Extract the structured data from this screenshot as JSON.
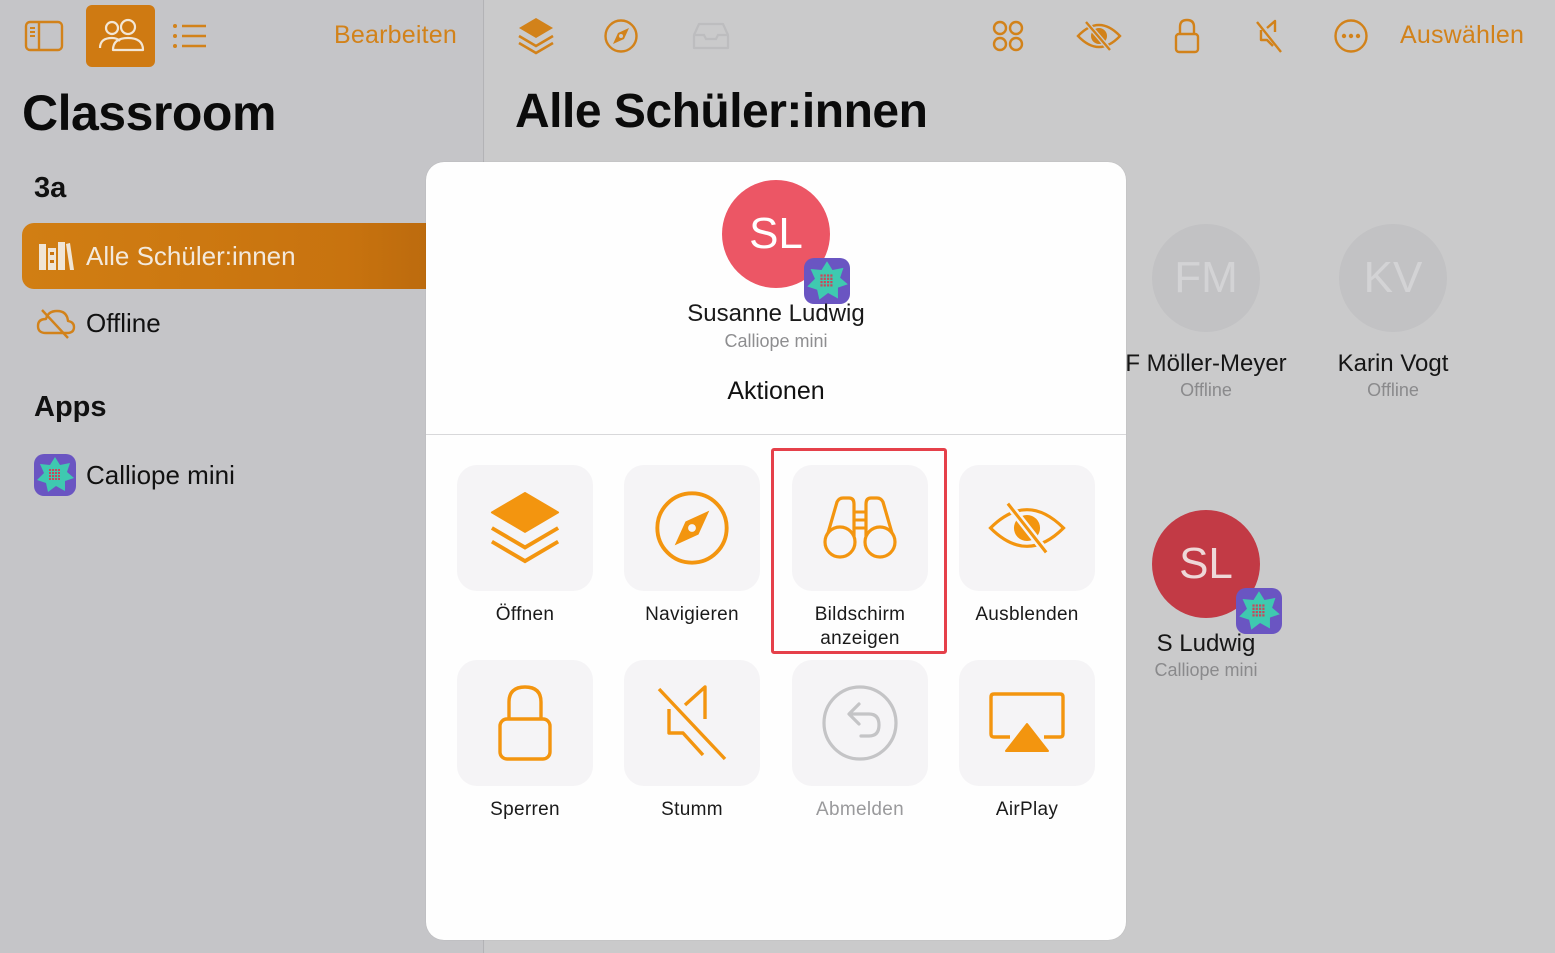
{
  "colors": {
    "accent": "#cf7a12",
    "icon_orange": "#f3950f",
    "avatar_pink": "#ec5665",
    "highlight_red": "#e5404a",
    "calliope_purple": "#6a55c2",
    "calliope_teal": "#3fc9b0"
  },
  "sidebar": {
    "toolbar": {
      "sidebar_toggle_icon": "sidebar-icon",
      "people_icon": "people-icon",
      "list_icon": "list-icon",
      "edit_label": "Bearbeiten"
    },
    "title": "Classroom",
    "class_section": "3a",
    "items": [
      {
        "label": "Alle Schüler:innen",
        "icon": "books-icon",
        "active": true
      },
      {
        "label": "Offline",
        "icon": "cloud-off-icon",
        "active": false
      }
    ],
    "apps_section": "Apps",
    "apps": [
      {
        "label": "Calliope mini",
        "icon": "calliope-app-icon"
      }
    ]
  },
  "main": {
    "toolbar": {
      "icons": [
        "layers-icon",
        "compass-icon",
        "tray-icon",
        "group-icon",
        "eye-slash-icon",
        "lock-icon",
        "mute-icon",
        "more-icon"
      ],
      "select_label": "Auswählen"
    },
    "title": "Alle Schüler:innen",
    "students": [
      {
        "initials": "FM",
        "name": "F Möller-Meyer",
        "status": "Offline"
      },
      {
        "initials": "KV",
        "name": "Karin Vogt",
        "status": "Offline"
      },
      {
        "initials": "SL",
        "name": "S Ludwig",
        "status": "Calliope mini"
      }
    ]
  },
  "modal": {
    "initials": "SL",
    "name": "Susanne Ludwig",
    "subtitle": "Calliope mini",
    "section_title": "Aktionen",
    "actions": [
      {
        "label": "Öffnen",
        "icon": "layers-icon",
        "disabled": false
      },
      {
        "label": "Navigieren",
        "icon": "compass-icon",
        "disabled": false
      },
      {
        "label": "Bildschirm anzeigen",
        "label_line1": "Bildschirm",
        "label_line2": "anzeigen",
        "icon": "binoculars-icon",
        "disabled": false,
        "highlighted": true
      },
      {
        "label": "Ausblenden",
        "icon": "eye-slash-icon",
        "disabled": false
      },
      {
        "label": "Sperren",
        "icon": "lock-icon",
        "disabled": false
      },
      {
        "label": "Stumm",
        "icon": "mute-icon",
        "disabled": false
      },
      {
        "label": "Abmelden",
        "icon": "logout-icon",
        "disabled": true
      },
      {
        "label": "AirPlay",
        "icon": "airplay-icon",
        "disabled": false
      }
    ]
  }
}
